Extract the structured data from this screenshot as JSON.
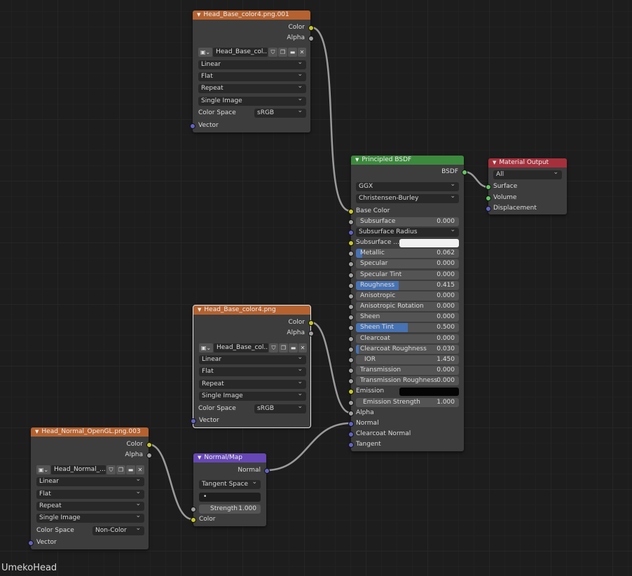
{
  "tree_name": "UmekoHead",
  "image_node_options": {
    "interpolation": "Linear",
    "projection": "Flat",
    "extension": "Repeat",
    "source": "Single Image",
    "color_space_label": "Color Space",
    "vector_label": "Vector",
    "out_color": "Color",
    "out_alpha": "Alpha"
  },
  "nodes": {
    "tex1": {
      "title": "Head_Base_color4.png.001",
      "image": "Head_Base_col...",
      "color_space": "sRGB"
    },
    "tex2": {
      "title": "Head_Base_color4.png",
      "image": "Head_Base_col...",
      "color_space": "sRGB"
    },
    "tex3": {
      "title": "Head_Normal_OpenGL.png.003",
      "image": "Head_Normal_...",
      "color_space": "Non-Color"
    },
    "normal_map": {
      "title": "Normal/Map",
      "output": "Normal",
      "space": "Tangent Space",
      "uv": "•",
      "strength_label": "Strength",
      "strength": "1.000",
      "color_input": "Color"
    },
    "bsdf": {
      "title": "Principled BSDF",
      "output": "BSDF",
      "distribution": "GGX",
      "subsurface_method": "Christensen-Burley",
      "base_color": "Base Color",
      "subsurface_radius": "Subsurface Radius",
      "subsurface_color": "Subsurface ...",
      "sliders": [
        {
          "label": "Subsurface",
          "value": "0.000",
          "fill": 0
        },
        {
          "label": "Metallic",
          "value": "0.062",
          "fill": 0.062
        },
        {
          "label": "Specular",
          "value": "0.000",
          "fill": 0
        },
        {
          "label": "Specular Tint",
          "value": "0.000",
          "fill": 0
        },
        {
          "label": "Roughness",
          "value": "0.415",
          "fill": 0.415
        },
        {
          "label": "Anisotropic",
          "value": "0.000",
          "fill": 0
        },
        {
          "label": "Anisotropic Rotation",
          "value": "0.000",
          "fill": 0
        },
        {
          "label": "Sheen",
          "value": "0.000",
          "fill": 0
        },
        {
          "label": "Sheen Tint",
          "value": "0.500",
          "fill": 0.5
        },
        {
          "label": "Clearcoat",
          "value": "0.000",
          "fill": 0
        },
        {
          "label": "Clearcoat Roughness",
          "value": "0.030",
          "fill": 0.03
        },
        {
          "label": "IOR",
          "value": "1.450",
          "fill": 0
        },
        {
          "label": "Transmission",
          "value": "0.000",
          "fill": 0
        },
        {
          "label": "Transmission Roughness",
          "value": "0.000",
          "fill": 0
        }
      ],
      "emission": "Emission",
      "emission_strength_label": "Emission Strength",
      "emission_strength": "1.000",
      "alpha": "Alpha",
      "normal": "Normal",
      "clearcoat_normal": "Clearcoat Normal",
      "tangent": "Tangent"
    },
    "output": {
      "title": "Material Output",
      "target": "All",
      "surface": "Surface",
      "volume": "Volume",
      "displacement": "Displacement"
    }
  },
  "colors": {
    "texture_header": "#b56230",
    "shader_header": "#3c8a3d",
    "output_header": "#a5303c",
    "vector_header": "#6647b5",
    "color_socket": "#c7c729",
    "float_socket": "#a1a1a1",
    "vector_socket": "#6363c7",
    "shader_socket": "#63c763",
    "slider_fill": "#4772b3"
  }
}
